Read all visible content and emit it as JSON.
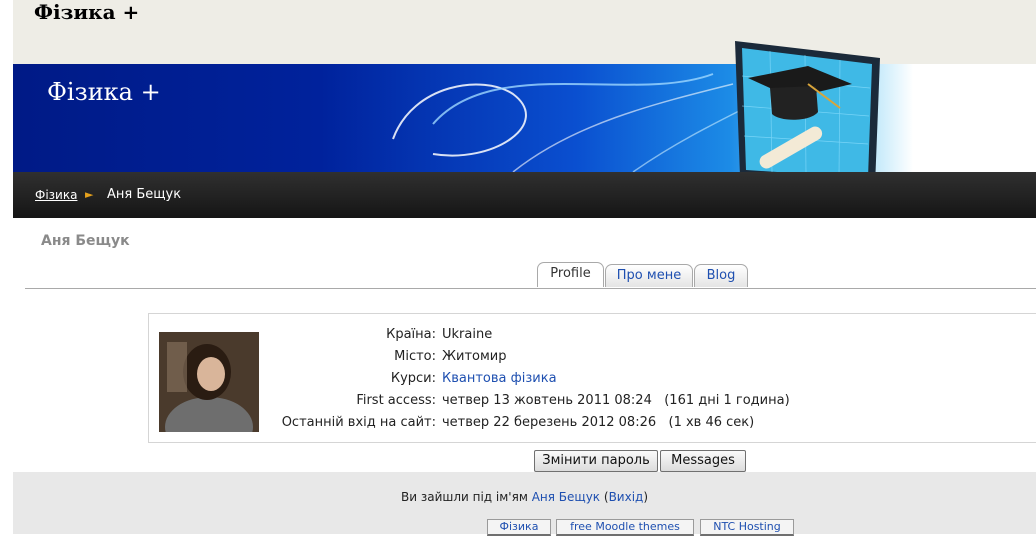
{
  "site": {
    "title": "Фізика +",
    "banner_title": "Фізика +"
  },
  "breadcrumb": {
    "home": "Фізика",
    "separator": "►",
    "current": "Аня Бещук"
  },
  "page": {
    "heading": "Аня Бещук"
  },
  "tabs": [
    {
      "label": "Profile",
      "active": true
    },
    {
      "label": "Про мене",
      "active": false
    },
    {
      "label": "Blog",
      "active": false
    }
  ],
  "profile": {
    "fields": [
      {
        "label": "Країна:",
        "value": "Ukraine"
      },
      {
        "label": "Місто:",
        "value": "Житомир"
      },
      {
        "label": "Курси:",
        "value": "Квантова фізика"
      },
      {
        "label": "First access:",
        "value": "четвер 13 жовтень 2011 08:24   (161 дні 1 година)"
      },
      {
        "label": "Останній вхід на сайт:",
        "value": "четвер 22 березень 2012 08:26   (1 хв 46 сек)"
      }
    ]
  },
  "buttons": {
    "change_password": "Змінити пароль",
    "messages": "Messages"
  },
  "footer": {
    "logged_in_prefix": "Ви зайшли під ім'ям ",
    "user_name": "Аня Бещук",
    "open_paren": " (",
    "logout": "Вихід",
    "close_paren": ")",
    "links": [
      "Фізика",
      "free Moodle themes",
      "NTC Hosting"
    ]
  },
  "colors": {
    "link": "#1e4fb0",
    "nav_bg": "#1f1f1f",
    "arrow": "#e6a11c",
    "banner_blue": "#00229c"
  },
  "icons": {
    "breadcrumb_arrow": "triangle-right-icon",
    "banner_art": "monitor-graduation-cap-icon"
  }
}
